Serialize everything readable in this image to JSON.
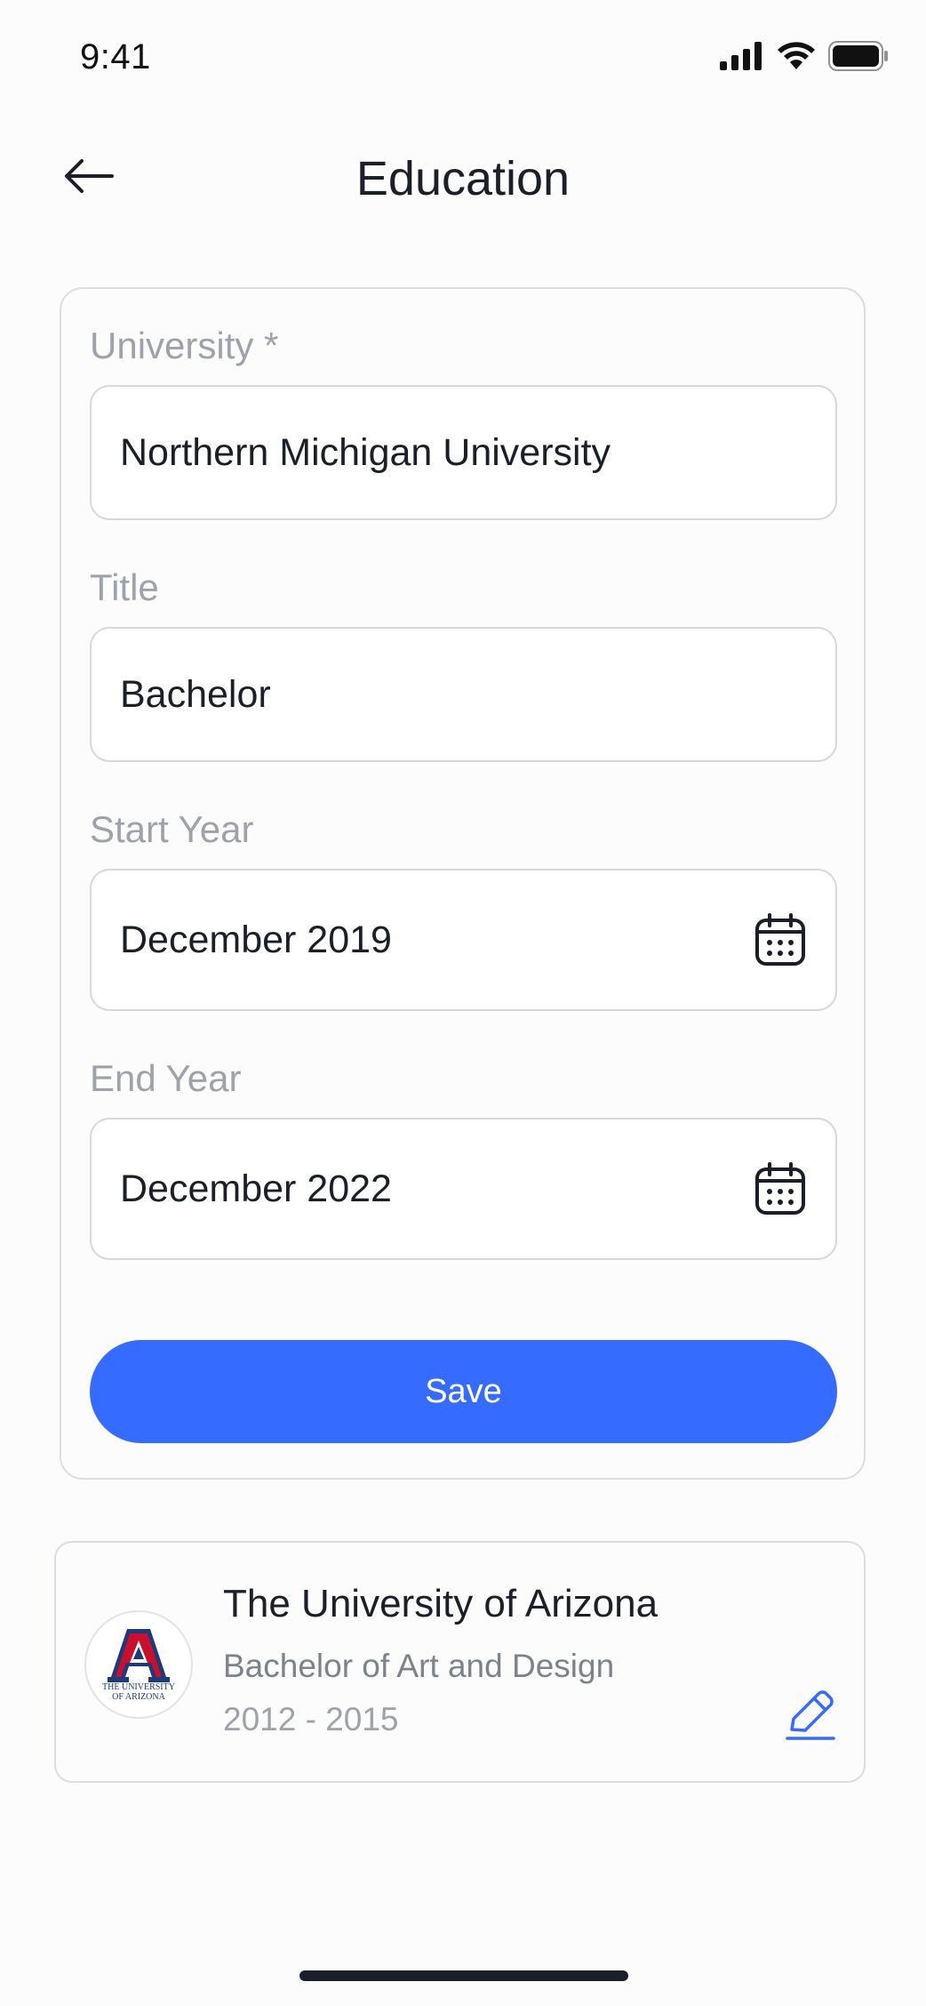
{
  "status_bar": {
    "time": "9:41"
  },
  "header": {
    "title": "Education"
  },
  "form": {
    "university": {
      "label": "University *",
      "value": "Northern Michigan University"
    },
    "title": {
      "label": "Title",
      "value": "Bachelor"
    },
    "start_year": {
      "label": "Start Year",
      "value": "December 2019"
    },
    "end_year": {
      "label": "End Year",
      "value": "December 2022"
    },
    "save_label": "Save"
  },
  "education_entry": {
    "logo_letter": "A",
    "logo_text_line1": "THE UNIVERSITY",
    "logo_text_line2": "OF ARIZONA",
    "name": "The University of Arizona",
    "degree": "Bachelor of Art and Design",
    "years": "2012 - 2015"
  },
  "colors": {
    "primary": "#356bff",
    "text": "#1b1f2b",
    "muted": "#9ea2ad",
    "logo_red": "#c8102e",
    "logo_navy": "#1e3a78"
  },
  "icons": [
    "back-arrow-icon",
    "calendar-icon",
    "edit-pencil-icon",
    "signal-icon",
    "wifi-icon",
    "battery-icon"
  ]
}
